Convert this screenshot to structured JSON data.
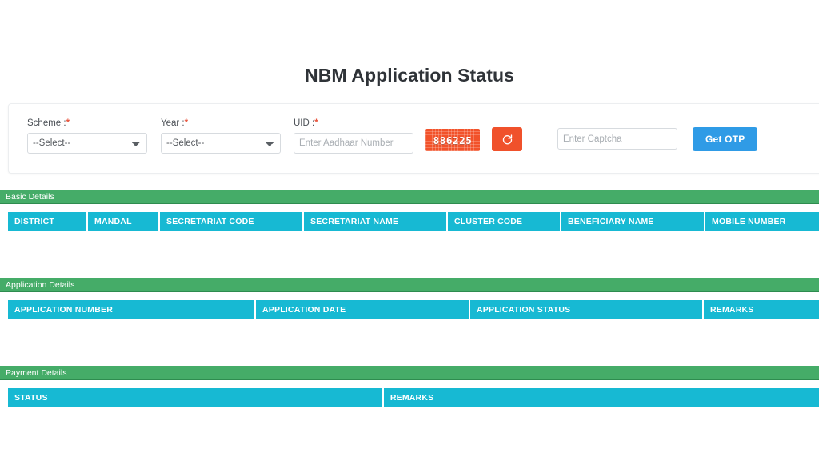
{
  "page": {
    "title": "NBM Application Status"
  },
  "form": {
    "scheme": {
      "label": "Scheme :",
      "required_mark": "*",
      "selected": "--Select--",
      "options": [
        "--Select--"
      ]
    },
    "year": {
      "label": "Year :",
      "required_mark": "*",
      "selected": "--Select--",
      "options": [
        "--Select--"
      ]
    },
    "uid": {
      "label": "UID :",
      "required_mark": "*",
      "value": "",
      "placeholder": "Enter Aadhaar Number"
    },
    "captcha": {
      "code": "886225",
      "refresh_icon": "refresh-icon",
      "input_value": "",
      "input_placeholder": "Enter Captcha"
    },
    "get_otp_label": "Get OTP"
  },
  "sections": [
    {
      "id": "basic",
      "title": "Basic Details",
      "columns": [
        "DISTRICT",
        "MANDAL",
        "SECRETARIAT CODE",
        "SECRETARIAT NAME",
        "CLUSTER CODE",
        "BENEFICIARY NAME",
        "MOBILE NUMBER"
      ],
      "rows": []
    },
    {
      "id": "application",
      "title": "Application Details",
      "columns": [
        "APPLICATION NUMBER",
        "APPLICATION DATE",
        "APPLICATION STATUS",
        "REMARKS"
      ],
      "rows": []
    },
    {
      "id": "payment",
      "title": "Payment Details",
      "columns": [
        "STATUS",
        "REMARKS"
      ],
      "rows": []
    }
  ],
  "colors": {
    "section_header_green": "#45ac68",
    "table_header_cyan": "#17b9d3",
    "primary_blue": "#2f9be6",
    "captcha_orange": "#f2522a",
    "required_red": "#e8563f"
  }
}
